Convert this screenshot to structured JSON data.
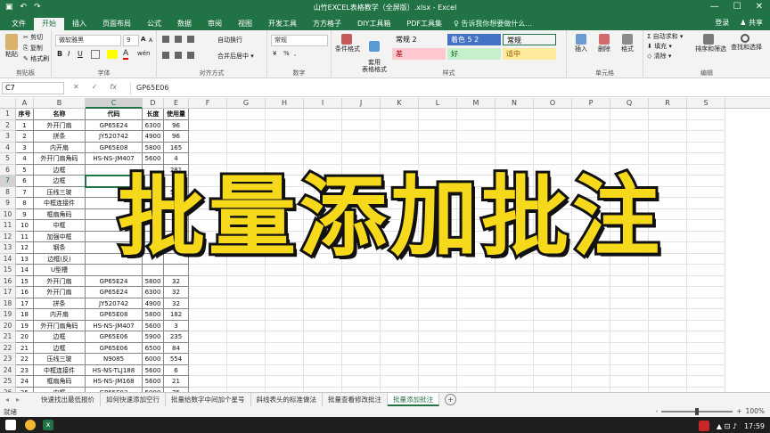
{
  "window": {
    "title": "山竹EXCEL表格教学（全屏版）.xlsx - Excel",
    "controls": {
      "minimize": "—",
      "maximize": "☐",
      "close": "✕"
    },
    "qa": {
      "save": "▣",
      "undo": "↶",
      "redo": "↷"
    }
  },
  "tabs": [
    "文件",
    "开始",
    "插入",
    "页面布局",
    "公式",
    "数据",
    "审阅",
    "视图",
    "开发工具",
    "方方格子",
    "DIY工具箱",
    "PDF工具集"
  ],
  "tell_me": "♀ 告诉我你想要做什么...",
  "account": {
    "login": "登录",
    "share": "♟ 共享"
  },
  "ribbon": {
    "clipboard": {
      "label": "剪贴板",
      "paste": "粘贴",
      "cut": "✂ 剪切",
      "copy": "⎘ 复制",
      "format_painter": "✎ 格式刷"
    },
    "font": {
      "label": "字体",
      "font_name": "微软雅黑",
      "font_size": "9",
      "grow": "A",
      "shrink": "A",
      "bold": "B",
      "italic": "I",
      "underline": "U",
      "phonetic": "wén"
    },
    "alignment": {
      "label": "对齐方式",
      "wrap": "自动换行",
      "merge": "合并后居中 ▾"
    },
    "number": {
      "label": "数字",
      "format": "常规",
      "percent": "%",
      "comma": ",",
      "currency": "¥"
    },
    "styles": {
      "label": "样式",
      "conditional": "条件格式",
      "table_format": "套用\n表格格式",
      "cells": [
        {
          "text": "常规 2",
          "bg": "#ffffff",
          "fg": "#000000"
        },
        {
          "text": "着色 5 2",
          "bg": "#4472c4",
          "fg": "#ffffff"
        },
        {
          "text": "常规",
          "bg": "#ffffff",
          "fg": "#000000"
        },
        {
          "text": "差",
          "bg": "#ffc7ce",
          "fg": "#9c0006"
        },
        {
          "text": "好",
          "bg": "#c6efce",
          "fg": "#006100"
        },
        {
          "text": "适中",
          "bg": "#ffeb9c",
          "fg": "#9c5700"
        }
      ]
    },
    "cells_group": {
      "label": "单元格",
      "insert": "插入",
      "delete": "删除",
      "format": "格式"
    },
    "editing": {
      "label": "编辑",
      "autosum": "Σ 自动求和 ▾",
      "fill": "⬇ 填充 ▾",
      "clear": "◇ 清除 ▾",
      "sort": "排序和筛选",
      "find": "查找和选择"
    }
  },
  "formula_bar": {
    "name_box": "C7",
    "cancel": "✕",
    "enter": "✓",
    "fx": "fx",
    "value": "GP65E06"
  },
  "columns": [
    "A",
    "B",
    "C",
    "D",
    "E",
    "F",
    "G",
    "H",
    "I",
    "J",
    "K",
    "L",
    "M",
    "N",
    "O",
    "P",
    "Q",
    "R",
    "S"
  ],
  "selected_column": "C",
  "selected_row": 7,
  "header_row": [
    "序号",
    "名称",
    "代码",
    "长度",
    "使用量"
  ],
  "rows": [
    [
      "1",
      "外开门扇",
      "GP65E24",
      "6300",
      "96"
    ],
    [
      "2",
      "拼条",
      "JY520742",
      "4900",
      "96"
    ],
    [
      "3",
      "内开扇",
      "GP65E08",
      "5800",
      "165"
    ],
    [
      "4",
      "外开门扇角码",
      "HS-NS-JM407",
      "5600",
      "4"
    ],
    [
      "5",
      "边框",
      "",
      "",
      "281"
    ],
    [
      "6",
      "边框",
      "",
      "",
      "34"
    ],
    [
      "7",
      "压线三玻",
      "",
      "",
      "552"
    ],
    [
      "8",
      "中框连接件",
      "",
      "",
      ""
    ],
    [
      "9",
      "框扇角码",
      "",
      "",
      ""
    ],
    [
      "10",
      "中框",
      "",
      "",
      ""
    ],
    [
      "11",
      "加强中框",
      "",
      "",
      "48"
    ],
    [
      "12",
      "钢条",
      "",
      "",
      ""
    ],
    [
      "13",
      "边框(反)",
      "",
      "",
      ""
    ],
    [
      "14",
      "U型槽",
      "",
      "",
      ""
    ],
    [
      "15",
      "外开门扇",
      "GP65E24",
      "5800",
      "32"
    ],
    [
      "16",
      "外开门扇",
      "GP65E24",
      "6300",
      "32"
    ],
    [
      "17",
      "拼条",
      "JY520742",
      "4900",
      "32"
    ],
    [
      "18",
      "内开扇",
      "GP65E08",
      "5800",
      "182"
    ],
    [
      "19",
      "外开门扇角码",
      "HS-NS-JM407",
      "5600",
      "3"
    ],
    [
      "20",
      "边框",
      "GP65E06",
      "5900",
      "235"
    ],
    [
      "21",
      "边框",
      "GP65E06",
      "6500",
      "84"
    ],
    [
      "22",
      "压线三玻",
      "N9085",
      "6000",
      "554"
    ],
    [
      "23",
      "中框连接件",
      "HS-NS-TLJ188",
      "5600",
      "6"
    ],
    [
      "24",
      "框扇角码",
      "HS-NS-JM168",
      "5600",
      "21"
    ],
    [
      "25",
      "中框",
      "GP65E03",
      "5900",
      "75"
    ]
  ],
  "overlay_title": "批量添加批注",
  "sheets": [
    "快速找出最低报价",
    "如何快速添加空行",
    "批量给数字中间加个星号",
    "斜线表头的标准做法",
    "批量查看修改批注",
    "批量添加批注"
  ],
  "active_sheet": "批量添加批注",
  "status": {
    "mode": "就绪",
    "zoom": "100%",
    "minus": "-",
    "plus": "+"
  },
  "taskbar": {
    "time": "17:59",
    "tray_icons": "▲ ⊡ ♪"
  }
}
